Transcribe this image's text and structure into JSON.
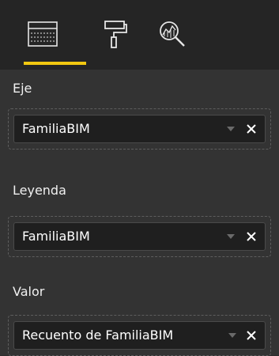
{
  "tabs": [
    {
      "icon": "fields-grid-icon"
    },
    {
      "icon": "paint-roller-icon"
    },
    {
      "icon": "analytics-magnifier-icon"
    }
  ],
  "accent_color": "#f2c811",
  "sections": {
    "axis": {
      "label": "Eje",
      "value": "FamiliaBIM"
    },
    "legend": {
      "label": "Leyenda",
      "value": "FamiliaBIM"
    },
    "values": {
      "label": "Valor",
      "value": "Recuento de FamiliaBIM"
    }
  },
  "icons": {
    "dropdown": "chevron-down-icon",
    "remove": "close-icon"
  }
}
